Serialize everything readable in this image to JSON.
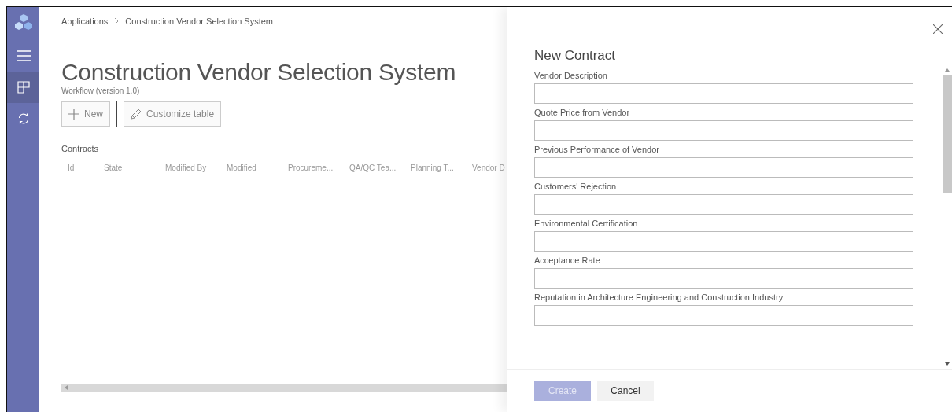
{
  "sidebar": {
    "items": [
      {
        "kind": "menu",
        "selected": false
      },
      {
        "kind": "grid",
        "selected": true
      },
      {
        "kind": "refresh",
        "selected": false
      }
    ]
  },
  "breadcrumb": [
    "Applications",
    "Construction Vendor Selection System"
  ],
  "page": {
    "title": "Construction Vendor Selection System",
    "subtitle": "Workflow (version 1.0)"
  },
  "toolbar": [
    {
      "kind": "add",
      "label": "New"
    },
    {
      "kind": "edit",
      "label": "Customize table"
    }
  ],
  "table": {
    "title": "Contracts",
    "columns": [
      "Id",
      "State",
      "Modified By",
      "Modified",
      "Procureme...",
      "QA/QC Tea...",
      "Planning T...",
      "Vendor D"
    ]
  },
  "panel": {
    "title": "New Contract",
    "fields": [
      {
        "label": "Vendor Description"
      },
      {
        "label": "Quote Price from Vendor"
      },
      {
        "label": "Previous Performance of Vendor"
      },
      {
        "label": "Customers' Rejection"
      },
      {
        "label": "Environmental Certification"
      },
      {
        "label": "Acceptance Rate"
      },
      {
        "label": "Reputation in Architecture Engineering and Construction Industry"
      }
    ],
    "buttons": [
      {
        "kind": "primary",
        "label": "Create",
        "disabled": true
      },
      {
        "kind": "secondary",
        "label": "Cancel",
        "disabled": false
      }
    ]
  }
}
